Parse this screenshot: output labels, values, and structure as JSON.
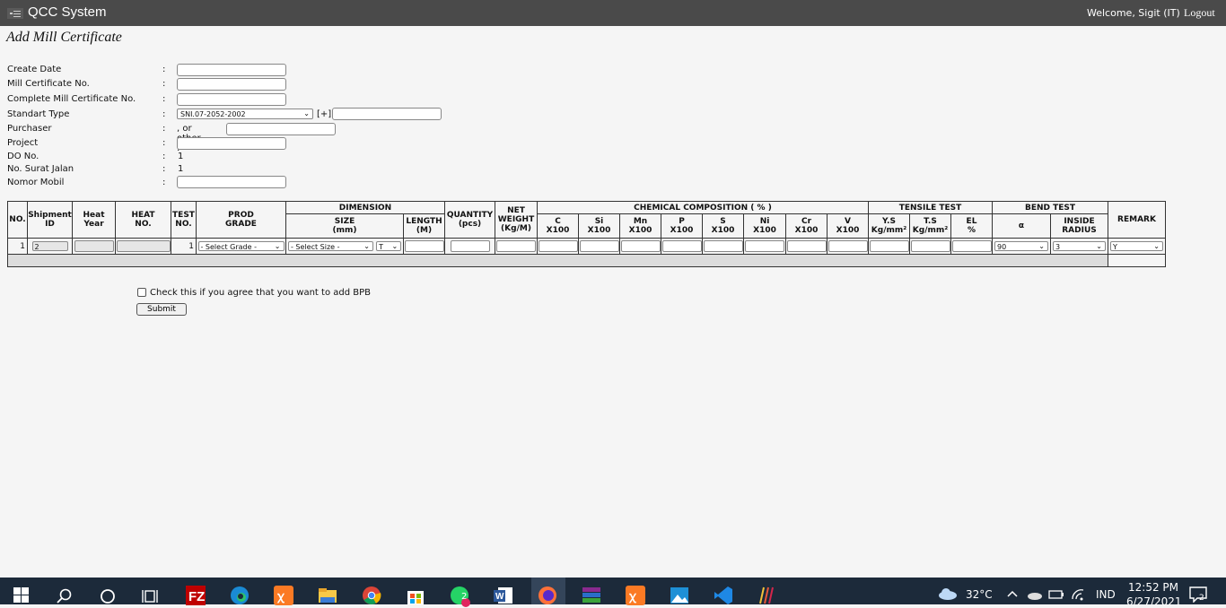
{
  "header": {
    "app_title": "QCC System",
    "welcome": "Welcome, Sigit (IT)",
    "logout": "Logout"
  },
  "page_title": "Add Mill Certificate",
  "form": {
    "create_date": "Create Date",
    "mill_cert_no": "Mill Certificate No.",
    "complete_mill_cert_no": "Complete Mill Certificate No.",
    "standart_type": "Standart Type",
    "standart_type_value": "SNI.07-2052-2002",
    "plus": "[+]",
    "purchaser": "Purchaser",
    "or_other": ", or other :",
    "project": "Project",
    "do_no": "DO No.",
    "do_no_value": "1",
    "no_surat_jalan": "No. Surat Jalan",
    "no_surat_jalan_value": "1",
    "nomor_mobil": "Nomor Mobil",
    "colon": ":"
  },
  "table": {
    "h_no": "NO.",
    "h_shipment_1": "Shipment",
    "h_shipment_2": "ID",
    "h_heat_year_1": "Heat",
    "h_heat_year_2": "Year",
    "h_heat_no_1": "HEAT",
    "h_heat_no_2": "NO.",
    "h_test_1": "TEST",
    "h_test_2": "NO.",
    "h_prod_1": "PROD",
    "h_prod_2": "GRADE",
    "h_dimension": "DIMENSION",
    "h_size_1": "SIZE",
    "h_size_2": "(mm)",
    "h_length_1": "LENGTH",
    "h_length_2": "(M)",
    "h_qty_1": "QUANTITY",
    "h_qty_2": "(pcs)",
    "h_net_1": "NET",
    "h_net_2": "WEIGHT",
    "h_net_3": "(Kg/M)",
    "h_chem": "CHEMICAL COMPOSITION ( % )",
    "chem": [
      {
        "a": "C",
        "b": "X100"
      },
      {
        "a": "Si",
        "b": "X100"
      },
      {
        "a": "Mn",
        "b": "X100"
      },
      {
        "a": "P",
        "b": "X100"
      },
      {
        "a": "S",
        "b": "X100"
      },
      {
        "a": "Ni",
        "b": "X100"
      },
      {
        "a": "Cr",
        "b": "X100"
      },
      {
        "a": "V",
        "b": "X100"
      }
    ],
    "h_tensile": "TENSILE TEST",
    "h_ys_1": "Y.S",
    "h_ys_2": "Kg/mm²",
    "h_ts_1": "T.S",
    "h_ts_2": "Kg/mm²",
    "h_el_1": "EL",
    "h_el_2": "%",
    "h_bend": "BEND TEST",
    "h_alpha": "α",
    "h_radius_1": "INSIDE",
    "h_radius_2": "RADIUS",
    "h_remark": "REMARK",
    "row": {
      "no": "1",
      "shipment_id": "2",
      "test_no": "1",
      "grade": "- Select Grade -",
      "size": "- Select Size -",
      "size_type": "T",
      "alpha": "90",
      "radius": "3",
      "remark": "Y"
    }
  },
  "agree_label": "Check this if you agree that you want to add BPB",
  "submit": "Submit",
  "taskbar": {
    "temp": "32°C",
    "lang": "IND",
    "time": "12:52 PM",
    "date": "6/27/2021",
    "notif": "2",
    "whatsapp_badge": "2"
  }
}
